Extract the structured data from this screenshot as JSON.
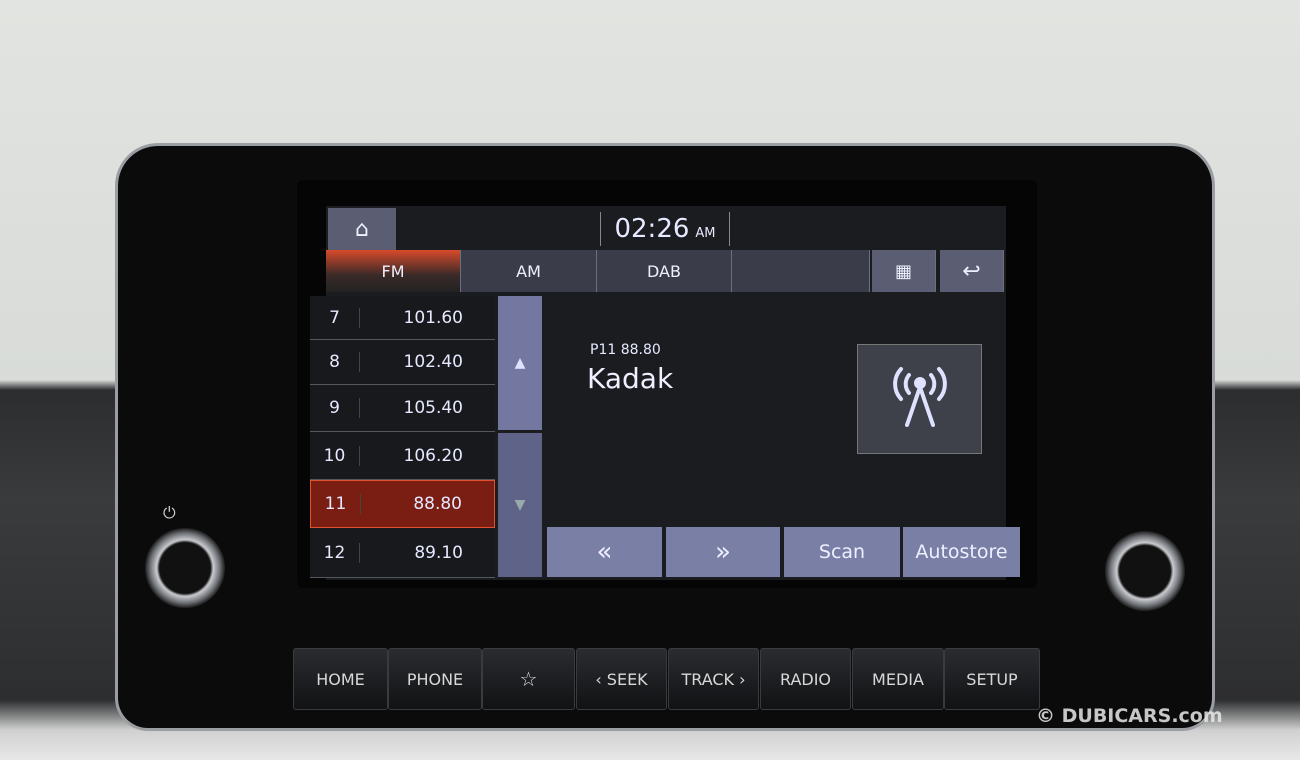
{
  "header": {
    "time": "02:26",
    "ampm": "AM"
  },
  "tabs": [
    {
      "label": "FM",
      "active": true
    },
    {
      "label": "AM"
    },
    {
      "label": "DAB"
    }
  ],
  "presets": [
    {
      "num": "7",
      "freq": "101.60"
    },
    {
      "num": "8",
      "freq": "102.40"
    },
    {
      "num": "9",
      "freq": "105.40"
    },
    {
      "num": "10",
      "freq": "106.20"
    },
    {
      "num": "11",
      "freq": "88.80",
      "selected": true
    },
    {
      "num": "12",
      "freq": "89.10"
    }
  ],
  "now_playing": {
    "preset_freq": "P11  88.80",
    "station": "Kadak"
  },
  "controls": {
    "prev": "«",
    "next": "»",
    "scan": "Scan",
    "autostore": "Autostore"
  },
  "hardware_buttons": [
    "HOME",
    "PHONE",
    "☆",
    "‹ SEEK",
    "TRACK ›",
    "RADIO",
    "MEDIA",
    "SETUP"
  ],
  "watermark": "© DUBICARS.com",
  "colors": {
    "accent": "#e0502c",
    "button": "#7a7fa6"
  }
}
